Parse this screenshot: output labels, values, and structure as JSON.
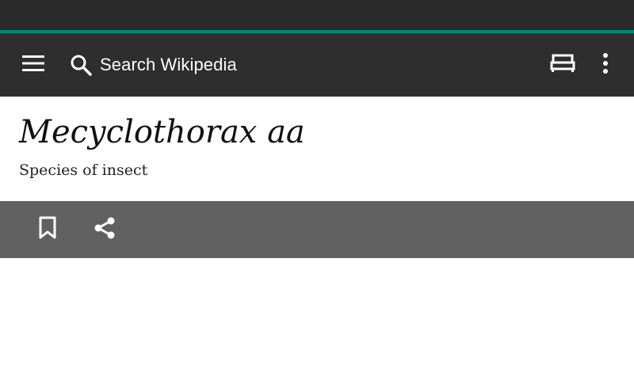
{
  "toolbar": {
    "menu_icon": "hamburger-menu-icon",
    "search_icon": "search-icon",
    "search_placeholder": "Search Wikipedia",
    "reading_list_icon": "reading-lists-icon",
    "overflow_icon": "more-vert-icon"
  },
  "article": {
    "title": "Mecyclothorax aa",
    "description": "Species of insect"
  },
  "actions": {
    "bookmark_icon": "bookmark-icon",
    "share_icon": "share-icon"
  },
  "colors": {
    "status_bar": "#2b2b2b",
    "accent": "#00897b",
    "toolbar": "#2e2e2e",
    "action_bar": "#616161"
  }
}
